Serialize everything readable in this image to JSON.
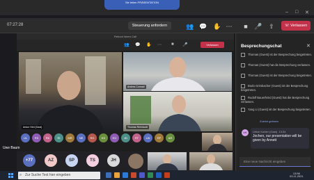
{
  "titlebar": {
    "share_pill": "Sie teilen PRÄSENTATION"
  },
  "meeting": {
    "timer": "07:27:28",
    "control_label": "Steuerung anfordern",
    "leave_label": "Verlassen",
    "chat_badge": "4"
  },
  "inner": {
    "title": "Reboot Ideen Call",
    "leave_label": "Verlassen"
  },
  "tiles": {
    "main_name": "Anton Hörl (Gast)",
    "top_right_name": "Andrea Conradi",
    "bottom_right_name": "Thomas Reinhardt"
  },
  "attendees_small": [
    "UL",
    "RS",
    "RK",
    "RI",
    "MR",
    "NE",
    "RG",
    "KS",
    "EG",
    "JD",
    "RT",
    "LW",
    "RF",
    "AR"
  ],
  "self_label": "Uwe Baum",
  "attendees": {
    "count": "+77",
    "a1": "AZ",
    "a2": "SP",
    "a3": "TS",
    "a4": "JH"
  },
  "chat": {
    "title": "Besprechungschat",
    "items": [
      "Thomas (Guest) ist der Besprechung beigetreten.",
      "Thomas (Guest) hat die Besprechung verlassen.",
      "Thomas (Guest) ist der Besprechung beigetreten.",
      "Bodo Grimbacher (Guest) ist der Besprechung beigetreten.",
      "Rudolf Bauerfeind (Guest) hat die Besprechung verlassen.",
      "Yang Li (Guest) ist der Besprechung beigetreten."
    ],
    "more": "Zuletzt gelesen",
    "message": {
      "avatar": "UK",
      "author": "Ulrich Kohler (Gast)",
      "time": "13:34",
      "text": "Jochen, our presentation will be given by Annett"
    },
    "compose_placeholder": "Eine neue Nachricht eingeben"
  },
  "taskbar": {
    "search_placeholder": "Zur Suche Text hier eingeben",
    "time": "13:56",
    "date": "03.11.2021"
  },
  "colors": {
    "leave": "#c4314b",
    "accent": "#6c79d6"
  }
}
